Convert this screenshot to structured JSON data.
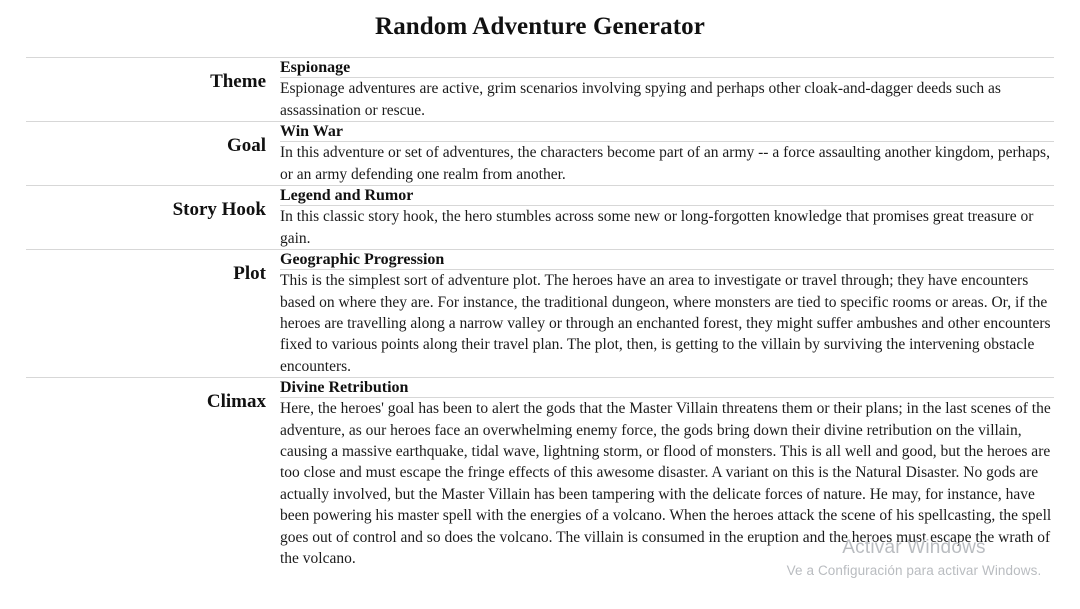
{
  "page": {
    "title": "Random Adventure Generator"
  },
  "entries": [
    {
      "label": "Theme",
      "name": "Espionage",
      "description": "Espionage adventures are active, grim scenarios involving spying and perhaps other cloak-and-dagger deeds such as assassination or rescue."
    },
    {
      "label": "Goal",
      "name": "Win War",
      "description": "In this adventure or set of adventures, the characters become part of an army -- a force assaulting another kingdom, perhaps, or an army defending one realm from another."
    },
    {
      "label": "Story Hook",
      "name": "Legend and Rumor",
      "description": "In this classic story hook, the hero stumbles across some new or long-forgotten knowledge that promises great treasure or gain."
    },
    {
      "label": "Plot",
      "name": "Geographic Progression",
      "description": "This is the simplest sort of adventure plot. The heroes have an area to investigate or travel through; they have encounters based on where they are. For instance, the traditional dungeon, where monsters are tied to specific rooms or areas. Or, if the heroes are travelling along a narrow valley or through an enchanted forest, they might suffer ambushes and other encounters fixed to various points along their travel plan. The plot, then, is getting to the villain by surviving the intervening obstacle encounters."
    },
    {
      "label": "Climax",
      "name": "Divine Retribution",
      "description": "Here, the heroes' goal has been to alert the gods that the Master Villain threatens them or their plans; in the last scenes of the adventure, as our heroes face an overwhelming enemy force, the gods bring down their divine retribution on the villain, causing a massive earthquake, tidal wave, lightning storm, or flood of monsters. This is all well and good, but the heroes are too close and must escape the fringe effects of this awesome disaster. A variant on this is the Natural Disaster. No gods are actually involved, but the Master Villain has been tampering with the delicate forces of nature. He may, for instance, have been powering his master spell with the energies of a volcano. When the heroes attack the scene of his spellcasting, the spell goes out of control and so does the volcano. The villain is consumed in the eruption and the heroes must escape the wrath of the volcano."
    }
  ],
  "watermark": {
    "title": "Activar Windows",
    "subtitle": "Ve a Configuración para activar Windows."
  },
  "colors": {
    "rule": "#d7d7d7",
    "text": "#1a1a1a",
    "watermark": "#b9bcc0",
    "background": "#ffffff"
  }
}
